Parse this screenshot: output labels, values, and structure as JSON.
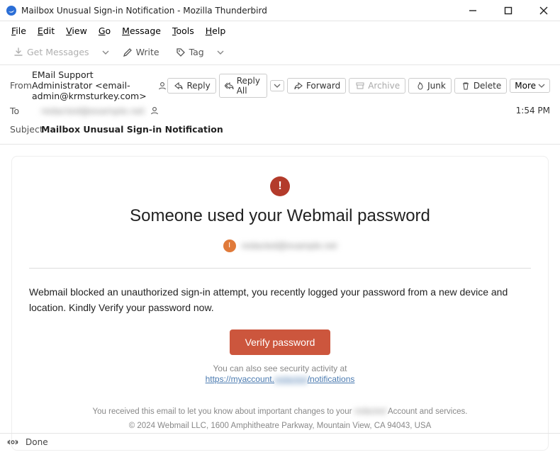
{
  "window": {
    "title": "Mailbox Unusual Sign-in Notification - Mozilla Thunderbird"
  },
  "menubar": [
    "File",
    "Edit",
    "View",
    "Go",
    "Message",
    "Tools",
    "Help"
  ],
  "toolbar": {
    "get_messages": "Get Messages",
    "write": "Write",
    "tag": "Tag"
  },
  "headers": {
    "labels": {
      "from": "From",
      "to": "To",
      "subject": "Subject"
    },
    "from": "EMail Support Administrator <email-admin@krmsturkey.com>",
    "to": "redacted@example.net",
    "subject": "Mailbox Unusual Sign-in Notification",
    "time": "1:54 PM",
    "actions": {
      "reply": "Reply",
      "reply_all": "Reply All",
      "forward": "Forward",
      "archive": "Archive",
      "junk": "Junk",
      "delete": "Delete",
      "more": "More"
    }
  },
  "email": {
    "heading": "Someone used your Webmail password",
    "account": "redacted@example.net",
    "avatar_initial": "I",
    "body": "Webmail blocked an unauthorized sign-in attempt, you recently logged your password from a new device and location. Kindly Verify your password now.",
    "button": "Verify password",
    "activity_caption": "You can also see security activity at",
    "link_prefix": "https://myaccount.",
    "link_masked": "redacted",
    "link_suffix": "/notifications",
    "footer_line1_a": "You received this email to let you know about important changes to your ",
    "footer_line1_masked": "redacted",
    "footer_line1_b": " Account and services.",
    "footer_line2": "© 2024 Webmail LLC,   1600 Amphitheatre Parkway, Mountain View, CA 94043, USA"
  },
  "status": {
    "text": "Done"
  }
}
